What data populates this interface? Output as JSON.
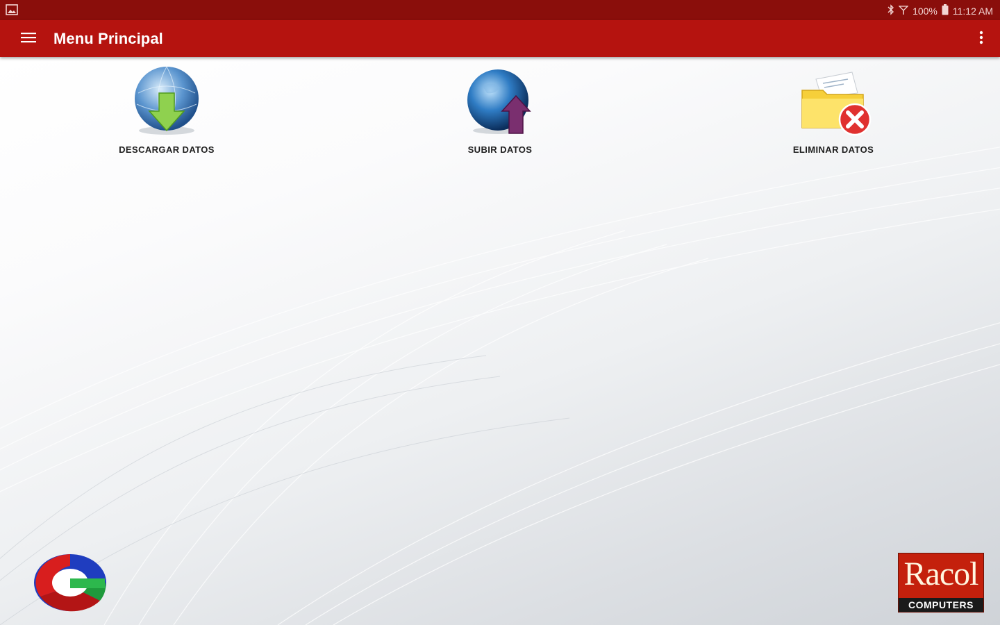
{
  "status_bar": {
    "battery": "100%",
    "time": "11:12 AM"
  },
  "app_bar": {
    "title": "Menu Principal",
    "menu_icon": "hamburger-menu-icon",
    "overflow_icon": "more-vert-icon"
  },
  "tiles": [
    {
      "label": "DESCARGAR DATOS",
      "icon": "globe-download-icon"
    },
    {
      "label": "SUBIR DATOS",
      "icon": "globe-upload-icon"
    },
    {
      "label": "ELIMINAR DATOS",
      "icon": "folder-delete-icon"
    }
  ],
  "footer": {
    "left_logo": "company-logo",
    "right_logo": {
      "name": "Racol",
      "tagline": "COMPUTERS"
    }
  },
  "colors": {
    "status_bar": "#8a0e0b",
    "app_bar": "#b5130f",
    "text_dark": "#1e1e1e"
  }
}
